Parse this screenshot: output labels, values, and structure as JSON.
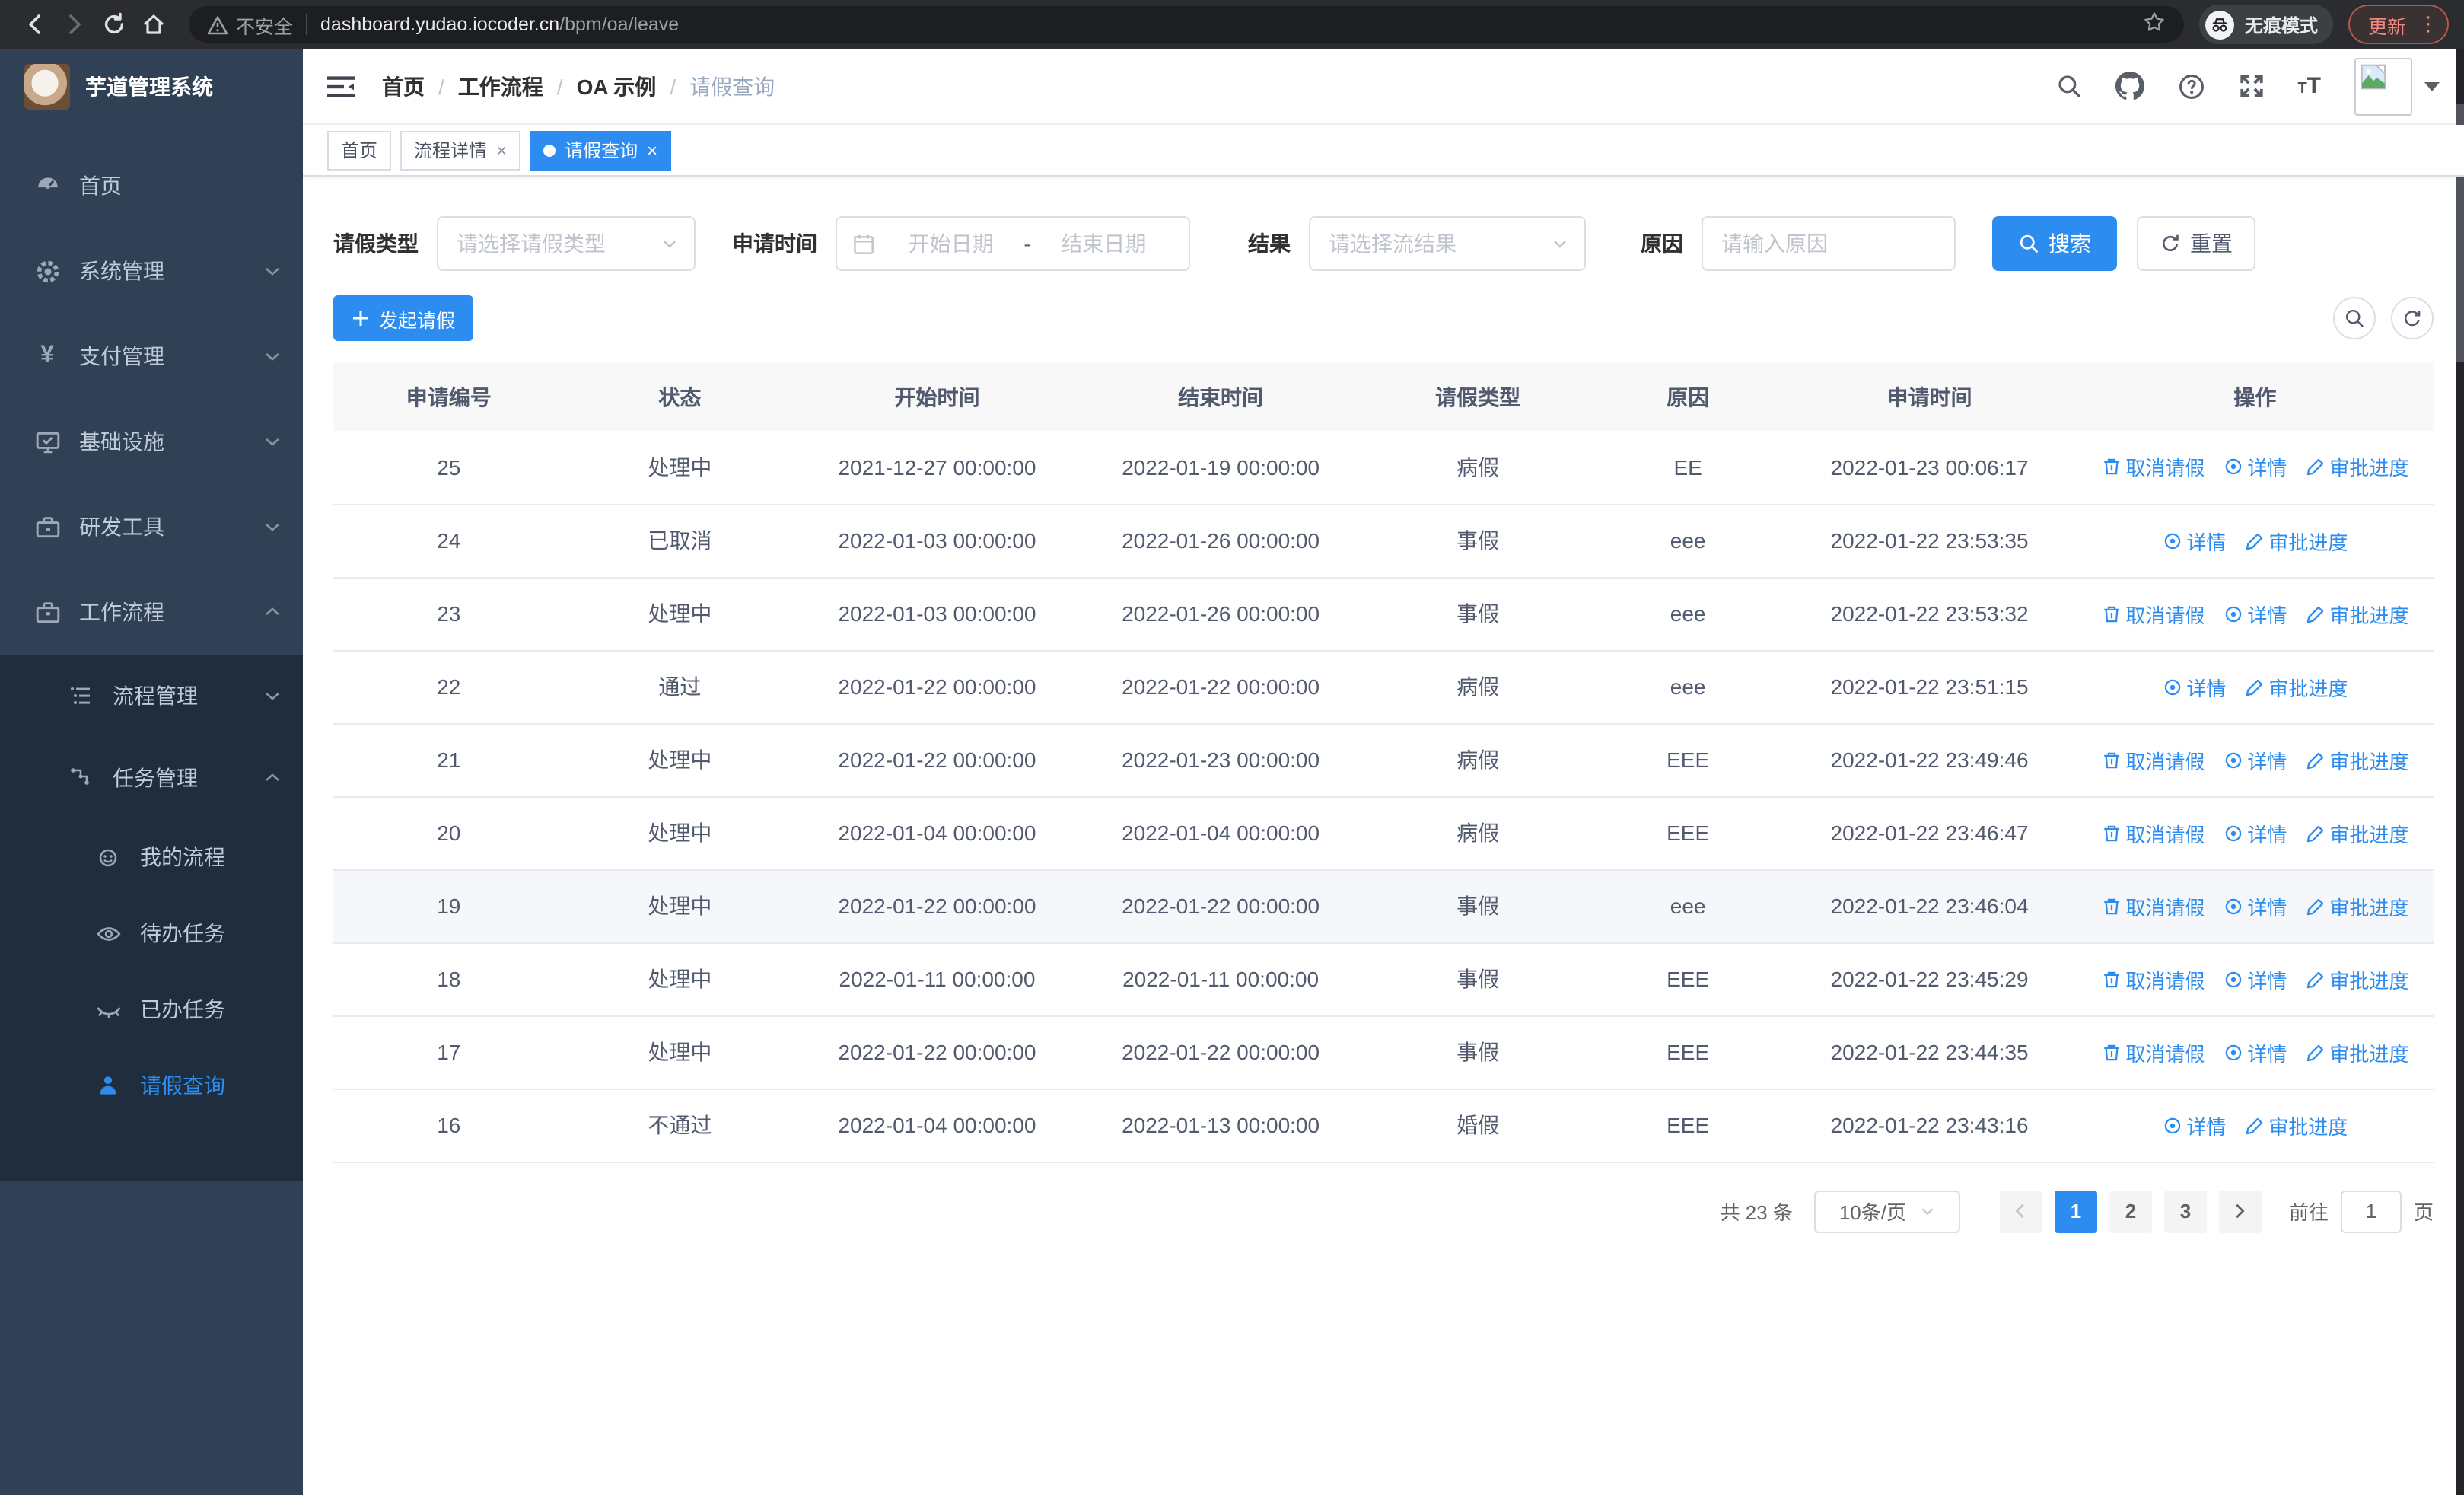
{
  "colors": {
    "accent": "#2d8cf0",
    "sidebar_bg": "#304156",
    "submenu_bg": "#1f2d3d",
    "update_red": "#f0867e"
  },
  "browser": {
    "security": "不安全",
    "domain": "dashboard.yudao.iocoder.cn",
    "path": "/bpm/oa/leave",
    "incognito": "无痕模式",
    "update": "更新"
  },
  "sidebar": {
    "title": "芋道管理系统",
    "items": [
      {
        "label": "首页"
      },
      {
        "label": "系统管理"
      },
      {
        "label": "支付管理"
      },
      {
        "label": "基础设施"
      },
      {
        "label": "研发工具"
      },
      {
        "label": "工作流程"
      },
      {
        "label": "流程管理"
      },
      {
        "label": "任务管理"
      },
      {
        "label": "我的流程"
      },
      {
        "label": "待办任务"
      },
      {
        "label": "已办任务"
      },
      {
        "label": "请假查询"
      }
    ]
  },
  "navbar": {
    "breadcrumb": [
      "首页",
      "工作流程",
      "OA 示例",
      "请假查询"
    ]
  },
  "tabs": [
    {
      "label": "首页"
    },
    {
      "label": "流程详情"
    },
    {
      "label": "请假查询"
    }
  ],
  "filters": {
    "leave_type_label": "请假类型",
    "leave_type_placeholder": "请选择请假类型",
    "apply_time_label": "申请时间",
    "start_placeholder": "开始日期",
    "range_separator": "-",
    "end_placeholder": "结束日期",
    "result_label": "结果",
    "result_placeholder": "请选择流结果",
    "reason_label": "原因",
    "reason_placeholder": "请输入原因",
    "search": "搜索",
    "reset": "重置"
  },
  "toolbar": {
    "create": "发起请假"
  },
  "action_labels": {
    "cancel": "取消请假",
    "detail": "详情",
    "progress": "审批进度"
  },
  "table": {
    "columns": [
      "申请编号",
      "状态",
      "开始时间",
      "结束时间",
      "请假类型",
      "原因",
      "申请时间",
      "操作"
    ],
    "highlighted_id": "19",
    "rows": [
      {
        "id": "25",
        "status": "处理中",
        "start": "2021-12-27 00:00:00",
        "end": "2022-01-19 00:00:00",
        "type": "病假",
        "reason": "EE",
        "apply_time": "2022-01-23 00:06:17",
        "actions": [
          "cancel",
          "detail",
          "progress"
        ]
      },
      {
        "id": "24",
        "status": "已取消",
        "start": "2022-01-03 00:00:00",
        "end": "2022-01-26 00:00:00",
        "type": "事假",
        "reason": "eee",
        "apply_time": "2022-01-22 23:53:35",
        "actions": [
          "detail",
          "progress"
        ]
      },
      {
        "id": "23",
        "status": "处理中",
        "start": "2022-01-03 00:00:00",
        "end": "2022-01-26 00:00:00",
        "type": "事假",
        "reason": "eee",
        "apply_time": "2022-01-22 23:53:32",
        "actions": [
          "cancel",
          "detail",
          "progress"
        ]
      },
      {
        "id": "22",
        "status": "通过",
        "start": "2022-01-22 00:00:00",
        "end": "2022-01-22 00:00:00",
        "type": "病假",
        "reason": "eee",
        "apply_time": "2022-01-22 23:51:15",
        "actions": [
          "detail",
          "progress"
        ]
      },
      {
        "id": "21",
        "status": "处理中",
        "start": "2022-01-22 00:00:00",
        "end": "2022-01-23 00:00:00",
        "type": "病假",
        "reason": "EEE",
        "apply_time": "2022-01-22 23:49:46",
        "actions": [
          "cancel",
          "detail",
          "progress"
        ]
      },
      {
        "id": "20",
        "status": "处理中",
        "start": "2022-01-04 00:00:00",
        "end": "2022-01-04 00:00:00",
        "type": "病假",
        "reason": "EEE",
        "apply_time": "2022-01-22 23:46:47",
        "actions": [
          "cancel",
          "detail",
          "progress"
        ]
      },
      {
        "id": "19",
        "status": "处理中",
        "start": "2022-01-22 00:00:00",
        "end": "2022-01-22 00:00:00",
        "type": "事假",
        "reason": "eee",
        "apply_time": "2022-01-22 23:46:04",
        "actions": [
          "cancel",
          "detail",
          "progress"
        ]
      },
      {
        "id": "18",
        "status": "处理中",
        "start": "2022-01-11 00:00:00",
        "end": "2022-01-11 00:00:00",
        "type": "事假",
        "reason": "EEE",
        "apply_time": "2022-01-22 23:45:29",
        "actions": [
          "cancel",
          "detail",
          "progress"
        ]
      },
      {
        "id": "17",
        "status": "处理中",
        "start": "2022-01-22 00:00:00",
        "end": "2022-01-22 00:00:00",
        "type": "事假",
        "reason": "EEE",
        "apply_time": "2022-01-22 23:44:35",
        "actions": [
          "cancel",
          "detail",
          "progress"
        ]
      },
      {
        "id": "16",
        "status": "不通过",
        "start": "2022-01-04 00:00:00",
        "end": "2022-01-13 00:00:00",
        "type": "婚假",
        "reason": "EEE",
        "apply_time": "2022-01-22 23:43:16",
        "actions": [
          "detail",
          "progress"
        ]
      }
    ]
  },
  "pagination": {
    "total": "共 23 条",
    "page_size": "10条/页",
    "pages": [
      "1",
      "2",
      "3"
    ],
    "active_page": "1",
    "goto_label": "前往",
    "goto_value": "1",
    "unit": "页"
  }
}
